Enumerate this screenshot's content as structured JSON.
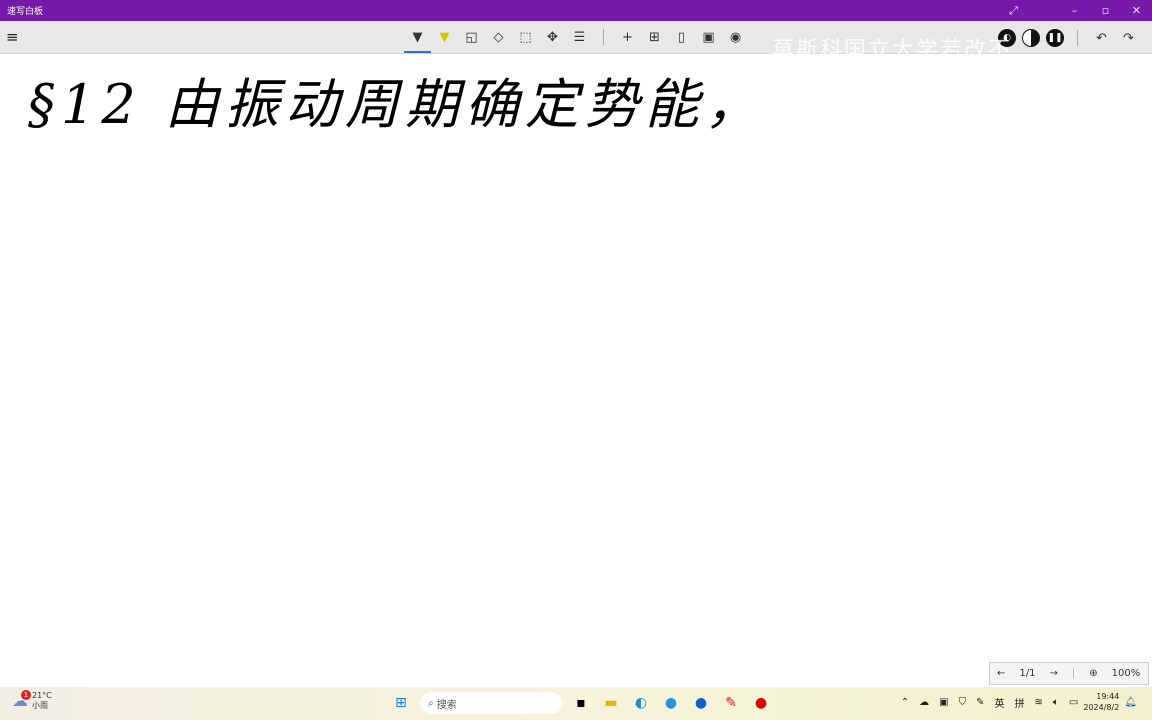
{
  "window": {
    "title": "速写白板",
    "buttons": [
      "expand-icon",
      "minimize",
      "maximize",
      "close"
    ]
  },
  "toolbar": {
    "tools": [
      "pen",
      "highlighter",
      "shapes",
      "eraser",
      "select",
      "move",
      "settings"
    ],
    "actions": [
      "add",
      "grid",
      "page",
      "save",
      "export"
    ],
    "right": [
      "color",
      "contrast",
      "pause",
      "undo",
      "redo"
    ]
  },
  "watermark": "莫斯科国立大学若改不",
  "canvas": {
    "handwriting": "§12 由振动周期确定势能，"
  },
  "pager": {
    "page": "1/1",
    "zoom": "100%"
  },
  "taskbar": {
    "weather": {
      "temp": "21°C",
      "desc": "小雨",
      "badge": "1"
    },
    "search_placeholder": "搜索",
    "ime1": "英",
    "ime2": "拼",
    "time": "19:44",
    "date": "2024/8/2"
  }
}
